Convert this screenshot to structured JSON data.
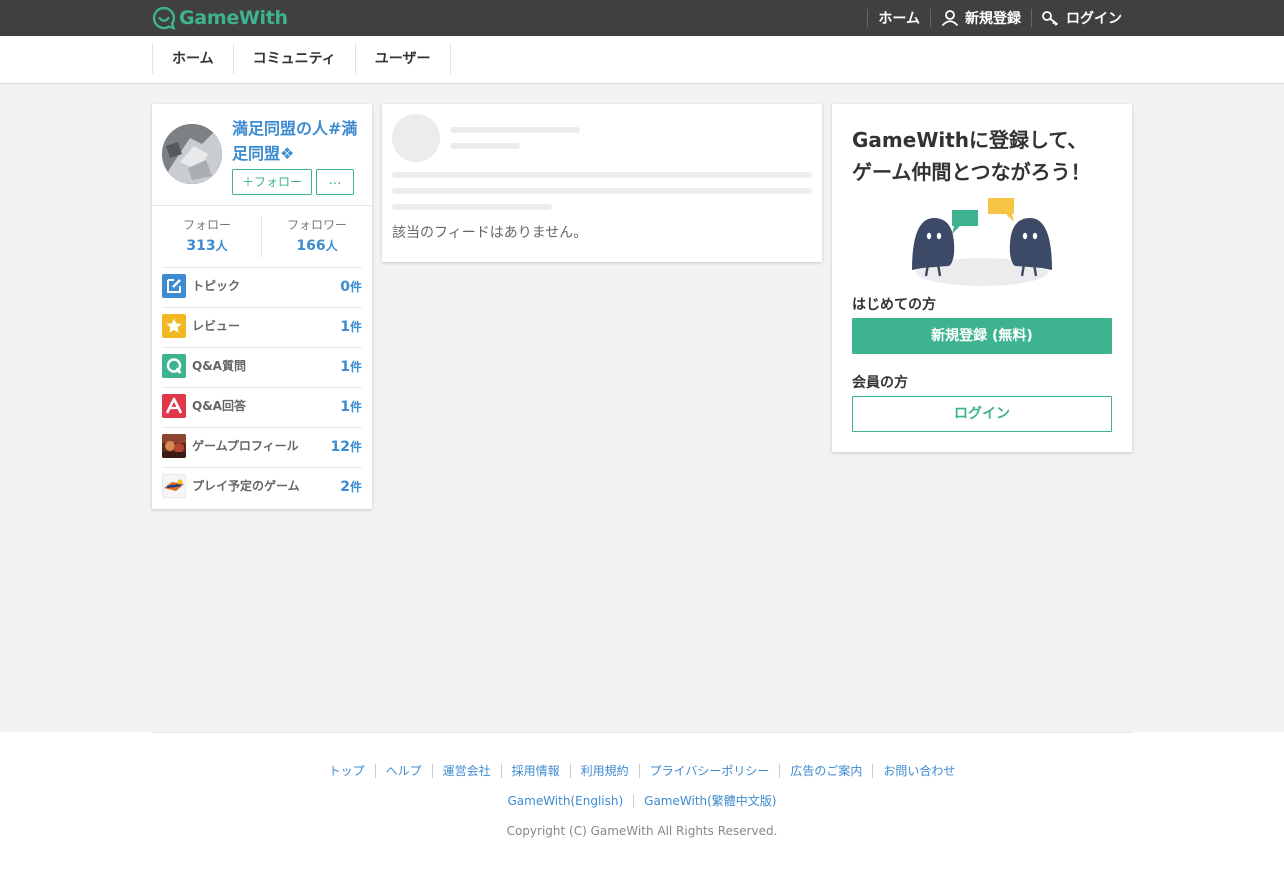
{
  "header": {
    "logo_text": "GameWith",
    "links": [
      "ホーム",
      "新規登録",
      "ログイン"
    ]
  },
  "nav": {
    "items": [
      "ホーム",
      "コミュニティ",
      "ユーザー"
    ]
  },
  "profile": {
    "name": "満足同盟の人#満足同盟❖",
    "follow_label": "＋フォロー",
    "more_label": "…",
    "stats": [
      {
        "label": "フォロー",
        "value": "313",
        "unit": "人"
      },
      {
        "label": "フォロワー",
        "value": "166",
        "unit": "人"
      }
    ],
    "rows": [
      {
        "icon": "edit-icon",
        "label": "トピック",
        "count": "0",
        "unit": "件"
      },
      {
        "icon": "star-icon",
        "label": "レビュー",
        "count": "1",
        "unit": "件"
      },
      {
        "icon": "question-icon",
        "label": "Q&A質問",
        "count": "1",
        "unit": "件"
      },
      {
        "icon": "answer-icon",
        "label": "Q&A回答",
        "count": "1",
        "unit": "件"
      },
      {
        "icon": "game-thumbnail-icon",
        "label": "ゲームプロフィール",
        "count": "12",
        "unit": "件"
      },
      {
        "icon": "game-logo-icon",
        "label": "プレイ予定のゲーム",
        "count": "2",
        "unit": "件"
      }
    ]
  },
  "feed": {
    "empty_message": "該当のフィードはありません。"
  },
  "signup": {
    "title_line1": "GameWithに登録して、",
    "title_line2": "ゲーム仲間とつながろう！",
    "first_time_label": "はじめての方",
    "register_button": "新規登録 (無料)",
    "member_label": "会員の方",
    "login_button": "ログイン"
  },
  "footer": {
    "links": [
      "トップ",
      "ヘルプ",
      "運営会社",
      "採用情報",
      "利用規約",
      "プライバシーポリシー",
      "広告のご案内",
      "お問い合わせ"
    ],
    "links2": [
      "GameWith(English)",
      "GameWith(繁體中文版)"
    ],
    "copyright": "Copyright (C) GameWith All Rights Reserved."
  },
  "colors": {
    "accent_green": "#3db38f",
    "link_blue": "#3d8bd0",
    "topbar": "#404040"
  }
}
